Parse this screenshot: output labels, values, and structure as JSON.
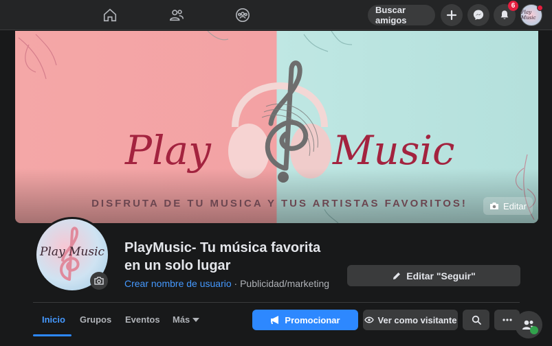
{
  "topbar": {
    "nav_icons": [
      "home-icon",
      "friends-icon",
      "groups-icon"
    ],
    "find_friends_label": "Buscar amigos",
    "notifications_count": "6"
  },
  "cover": {
    "word_left": "Play",
    "word_right": "Music",
    "tagline": "DISFRUTA DE TU MUSICA Y TUS ARTISTAS FAVORITOS!",
    "edit_label": "Editar"
  },
  "profile": {
    "avatar_text": "Play Music",
    "title": "PlayMusic- Tu música favorita en un solo lugar",
    "username_link": "Crear nombre de usuario",
    "category": " · Publicidad/marketing",
    "edit_follow_label": "Editar \"Seguir\""
  },
  "tabs": {
    "items": [
      "Inicio",
      "Grupos",
      "Eventos",
      "Más"
    ],
    "active": "Inicio"
  },
  "actions": {
    "promote_label": "Promocionar",
    "view_as_label": "Ver como visitante"
  },
  "colors": {
    "accent": "#2d88ff",
    "cover_pink": "#f3a2a4",
    "cover_mint": "#b4e0dc",
    "brand_text": "#a3233f"
  }
}
